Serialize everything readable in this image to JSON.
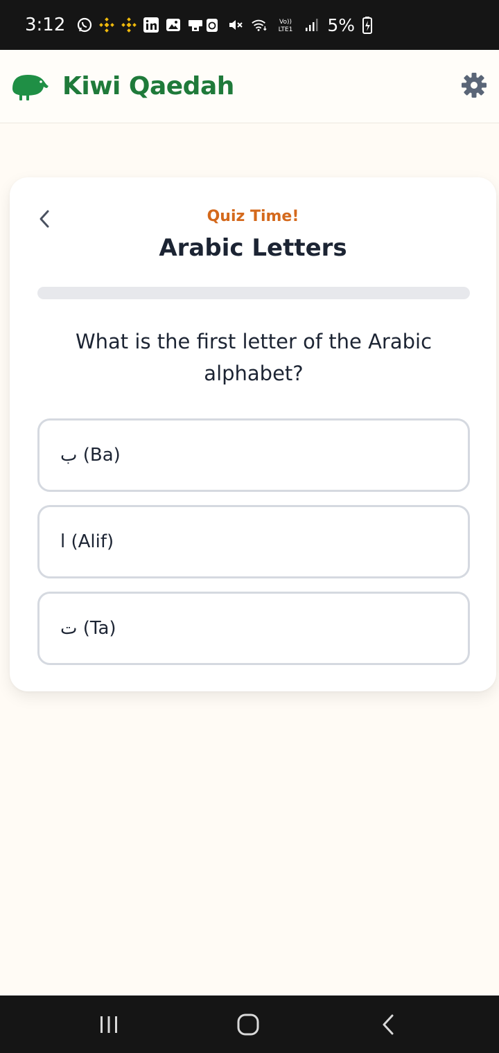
{
  "status_bar": {
    "time": "3:12",
    "battery": "5%",
    "icons_left": [
      "whatsapp-icon",
      "binance-icon",
      "binance-icon",
      "linkedin-icon",
      "gallery-icon",
      "sim-icon"
    ],
    "icons_right": [
      "recycle-icon",
      "mute-icon",
      "wifi-icon",
      "volte-icon",
      "signal-icon",
      "battery-icon"
    ],
    "volte_text": "Vo) LTE1"
  },
  "header": {
    "app_title": "Kiwi Qaedah",
    "brand_color": "#1f7a3a",
    "logo": "kiwi-bird-logo",
    "settings_icon": "gear-icon"
  },
  "quiz": {
    "label": "Quiz Time!",
    "label_color": "#d4691c",
    "title": "Arabic Letters",
    "progress": 0,
    "question": "What is the first letter of the Arabic alphabet?",
    "options": [
      {
        "label": "ب (Ba)"
      },
      {
        "label": "ا (Alif)"
      },
      {
        "label": "ت (Ta)"
      }
    ]
  },
  "nav": {
    "recents": "recents-icon",
    "home": "home-icon",
    "back": "back-icon"
  }
}
